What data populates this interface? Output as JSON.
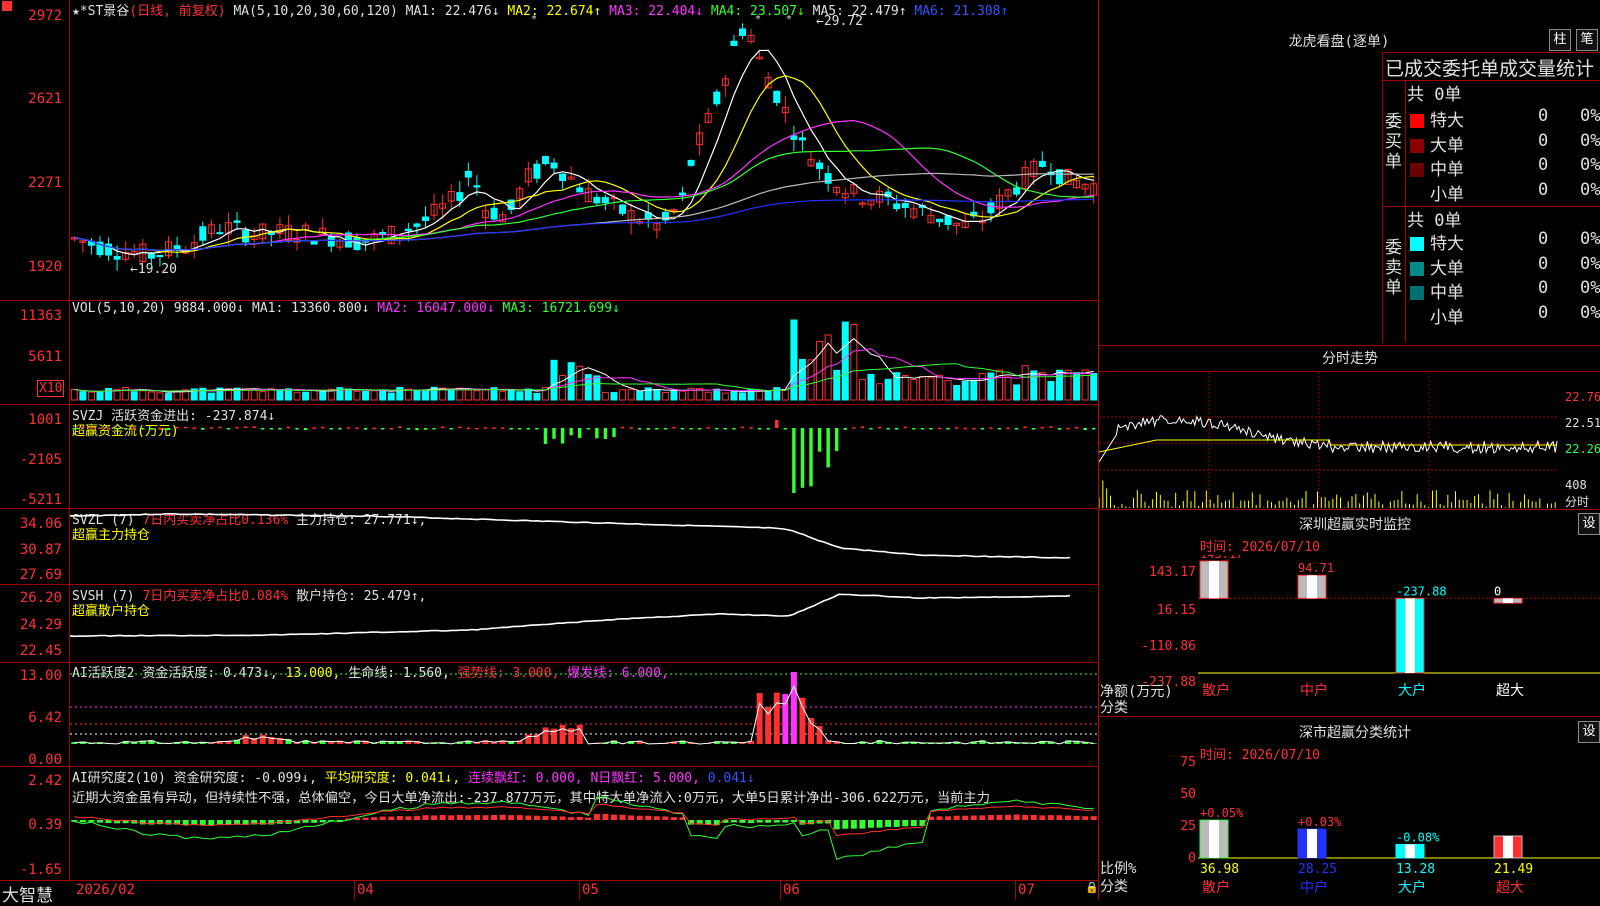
{
  "main": {
    "title": "★*ST景谷",
    "period": "(日线, 前复权)",
    "ma_params": "MA(5,10,20,30,60,120)",
    "ma1": "MA1: 22.476↓",
    "ma2": "MA2: 22.674↑",
    "ma3": "MA3: 22.404↓",
    "ma4": "MA4: 23.507↓",
    "ma5": "MA5: 22.479↑",
    "ma6": "MA6: 21.308↑",
    "high_marker": "29.72",
    "low_marker": "19.20",
    "y_ticks": [
      "2972",
      "2621",
      "2271",
      "1920"
    ]
  },
  "vol": {
    "label": "VOL(5,10,20)",
    "value": "9884.000↓",
    "ma1": "MA1: 13360.800↓",
    "ma2": "MA2: 16047.000↓",
    "ma3": "MA3: 16721.699↓",
    "y_ticks": [
      "11363",
      "5611"
    ],
    "unit": "X10"
  },
  "svzj": {
    "label": "SVZJ",
    "value": "活跃资金进出: -237.874↓",
    "sub": "超赢资金流(万元)",
    "y_ticks": [
      "1001",
      "-2105",
      "-5211"
    ]
  },
  "svzl": {
    "label": "SVZL (7)",
    "ratio": "7日内买卖净占比0.136%",
    "hold": "主力持仓: 27.771↓,",
    "sub": "超赢主力持仓",
    "y_ticks": [
      "34.06",
      "30.87",
      "27.69"
    ]
  },
  "svsh": {
    "label": "SVSH (7)",
    "ratio": "7日内买卖净占比0.084%",
    "hold": "散户持仓: 25.479↑,",
    "sub": "超赢散户持仓",
    "y_ticks": [
      "26.20",
      "24.29",
      "22.45"
    ]
  },
  "ai1": {
    "label": "AI活跃度2",
    "a": "资金活跃度: 0.473↓,",
    "b": "13.000,",
    "c": "生命线: 1.560,",
    "d": "强势线: 3.000,",
    "e": "爆发线: 6.000,",
    "y_ticks": [
      "13.00",
      "6.42",
      "0.00"
    ]
  },
  "ai2": {
    "label": "AI研究度2(10)",
    "a": "资金研究度: -0.099↓,",
    "b": "平均研究度: 0.041↓,",
    "c": "连续飘红: 0.000,",
    "d": "N日飘红: 5.000,",
    "e": "0.041↓",
    "text": "近期大资金虽有异动，但持续性不强，总体偏空，今日大单净流出:-237.877万元，其中特大单净流入:0万元，大单5日累计净出-306.622万元，当前主力",
    "y_ticks": [
      "2.42",
      "0.39",
      "-1.65"
    ]
  },
  "bottom": {
    "brand": "大智慧",
    "dates": [
      "2026/02",
      "04",
      "05",
      "06",
      "07"
    ]
  },
  "right": {
    "lhb_title": "龙虎看盘(逐单)",
    "btn_zhu": "柱",
    "btn_bi": "笔",
    "stats_title": "已成交委托单成交量统计",
    "buy_head": "共 0单",
    "buy_side": "委买单",
    "sell_head": "共 0单",
    "sell_side": "委卖单",
    "buy_rows": [
      {
        "name": "特大",
        "n": "0",
        "p": "0%",
        "color": "#ff0000"
      },
      {
        "name": "大单",
        "n": "0",
        "p": "0%",
        "color": "#8b0000"
      },
      {
        "name": "中单",
        "n": "0",
        "p": "0%",
        "color": "#6b0000"
      },
      {
        "name": "小单",
        "n": "0",
        "p": "0%",
        "color": "#000000"
      }
    ],
    "sell_rows": [
      {
        "name": "特大",
        "n": "0",
        "p": "0%",
        "color": "#00ffff"
      },
      {
        "name": "大单",
        "n": "0",
        "p": "0%",
        "color": "#008b8b"
      },
      {
        "name": "中单",
        "n": "0",
        "p": "0%",
        "color": "#007070"
      },
      {
        "name": "小单",
        "n": "0",
        "p": "0%",
        "color": "#000000"
      }
    ],
    "fs_title": "分时走势",
    "fs_ticks": [
      "22.76",
      "22.51",
      "22.26"
    ],
    "fs_vol": "408",
    "fs_unit": "分时",
    "monitor_title": "深圳超赢实时监控",
    "monitor_set": "设",
    "monitor_time": "时间: 2026/07/10",
    "monitor_ticks": [
      "143.17",
      "16.15",
      "-110.86",
      "-237.88"
    ],
    "monitor_ylabel": "净额(万元)",
    "monitor_xlabel": "分类",
    "monitor_values": [
      "143.17",
      "94.71",
      "-237.88",
      "0"
    ],
    "monitor_cats": [
      "散户",
      "中户",
      "大户",
      "超大"
    ],
    "class_title": "深市超赢分类统计",
    "class_set": "设",
    "class_time": "时间: 2026/07/10",
    "class_ticks": [
      "75",
      "50",
      "25",
      "0"
    ],
    "class_ylabel": "比例%",
    "class_xlabel": "分类",
    "class_changes": [
      "+0.05%",
      "+0.03%",
      "-0.08%"
    ],
    "class_values": [
      "36.98",
      "28.25",
      "13.28",
      "21.49"
    ],
    "class_cats": [
      "散户",
      "中户",
      "大户",
      "超大"
    ]
  }
}
